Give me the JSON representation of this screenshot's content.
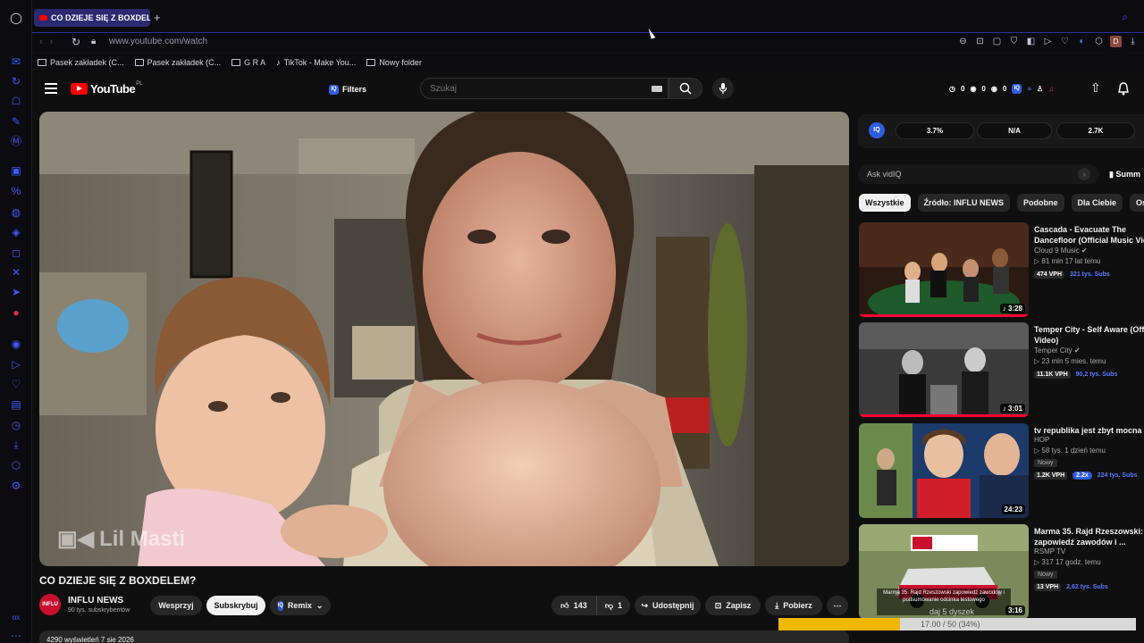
{
  "browser": {
    "tab_title": "CO DZIEJE SIĘ Z BOXDELEM",
    "new_tab": "+",
    "url": "www.youtube.com/watch",
    "bookmarks": [
      "Pasek zakładek (C...",
      "Pasek zakładek (C...",
      "G R A",
      "TikTok - Make You...",
      "Nowy folder"
    ],
    "profile_initial": "D"
  },
  "youtube": {
    "logo": "YouTube",
    "region": "PL",
    "filters_label": "Filters",
    "iq_badge": "IQ",
    "search_placeholder": "Szukaj",
    "header_stats": [
      "0",
      "0",
      "0"
    ]
  },
  "video": {
    "watermark": "Lil Masti",
    "title": "CO DZIEJE SIĘ Z BOXDELEM?",
    "channel": "INFLU NEWS",
    "channel_avatar": "INFLU",
    "subscribers": "90 tys. subskrybentów",
    "wesprzyj": "Wesprzyj",
    "subscribe": "Subskrybuj",
    "remix": "Remix",
    "likes": "143",
    "dislikes": "1",
    "share": "Udostępnij",
    "save": "Zapisz",
    "download": "Pobierz",
    "more": "⋯",
    "views_line": "4290 wyświetleń  7 sie 2026"
  },
  "vidiq": {
    "logo": "IQ",
    "metrics": [
      "3.7%",
      "N/A",
      "2.7K"
    ],
    "ask_placeholder": "Ask vidIQ",
    "summary": "Summ"
  },
  "chips": [
    "Wszystkie",
    "Źródło: INFLU NEWS",
    "Podobne",
    "Dla Ciebie",
    "Ostatnio"
  ],
  "recommendations": [
    {
      "title1": "Cascada - Evacuate The",
      "title2": "Dancefloor (Official Music Video)",
      "channel": "Cloud 9 Music ✔",
      "meta": "▷ 81 mln  17 lat temu",
      "vph": "474 VPH",
      "subs": "321 tys. Subs",
      "duration": "♪ 3:28"
    },
    {
      "title1": "Temper City - Self Aware (Official",
      "title2": "Video)",
      "channel": "Temper City ✔",
      "meta": "▷ 23 mln  5 mies. temu",
      "vph": "11.1K VPH",
      "subs": "90,2 tys. Subs",
      "duration": "♪ 3:01"
    },
    {
      "title1": "tv republika jest zbyt mocna",
      "title2": "",
      "channel": "HOP",
      "meta": "▷ 58 tys.  1 dzień temu",
      "badge": "Nowy",
      "vph": "1.2K VPH",
      "mult": "2.2x",
      "subs": "224 tys. Subs",
      "duration": "24:23"
    },
    {
      "title1": "Marma 35. Rajd Rzeszowski:",
      "title2": "zapowiedź zawodów i ...",
      "channel": "RSMP TV",
      "meta": "▷ 317  17 godz. temu",
      "badge": "Nowy",
      "vph": "13 VPH",
      "subs": "2,62 tys. Subs",
      "duration": "3:16",
      "thumb_text": "Marma 35. Rajd Rzeszowski zapowiedź zawodów i podsumowanie odcinka testowego"
    }
  ],
  "overlay": {
    "progress_text": "17.00 / 50 (34%)",
    "progress": 0.34,
    "caption": "daj 5 dyszek"
  },
  "colors": {
    "accent": "#3d5bff",
    "youtube_red": "#ff0000",
    "vidiq_blue": "#2f5de0"
  }
}
